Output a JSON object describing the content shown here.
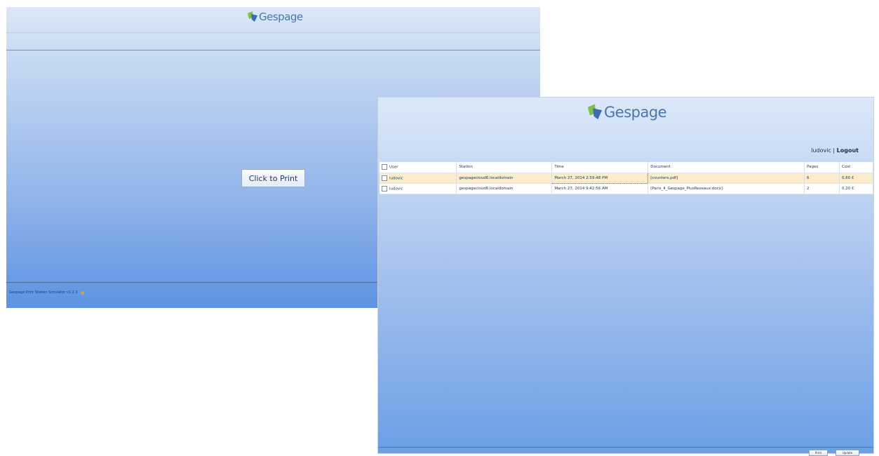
{
  "left_window": {
    "logo_text": "Gespage",
    "print_button": "Click to Print",
    "footer_text": "Gespage Print Station Simulator v1.2.3"
  },
  "right_window": {
    "logo_text": "Gespage",
    "user": {
      "name": "ludovic",
      "separator": "|",
      "logout": "Logout"
    },
    "table": {
      "columns": [
        "User",
        "Station",
        "Time",
        "Document",
        "Pages",
        "Cost"
      ],
      "rows": [
        {
          "user": "ludovic",
          "station": "gespagecloud6.localdomain",
          "time": "March 27, 2014 2:59:48 PM",
          "document": "[counters.pdf]",
          "pages": "6",
          "cost": "0.60 €",
          "selected": true
        },
        {
          "user": "ludovic",
          "station": "gespagecloud6.localdomain",
          "time": "March 27, 2014 9:42:56 AM",
          "document": "[Paris_4_Gespage_PlusReseaux.docx]",
          "pages": "2",
          "cost": "0.20 €",
          "selected": false
        }
      ]
    },
    "buttons": {
      "print": "Print",
      "update": "Update"
    }
  },
  "colors": {
    "logo_blue": "#4a78a8",
    "logo_green": "#7fc241",
    "selected_row": "#fbeccb"
  }
}
